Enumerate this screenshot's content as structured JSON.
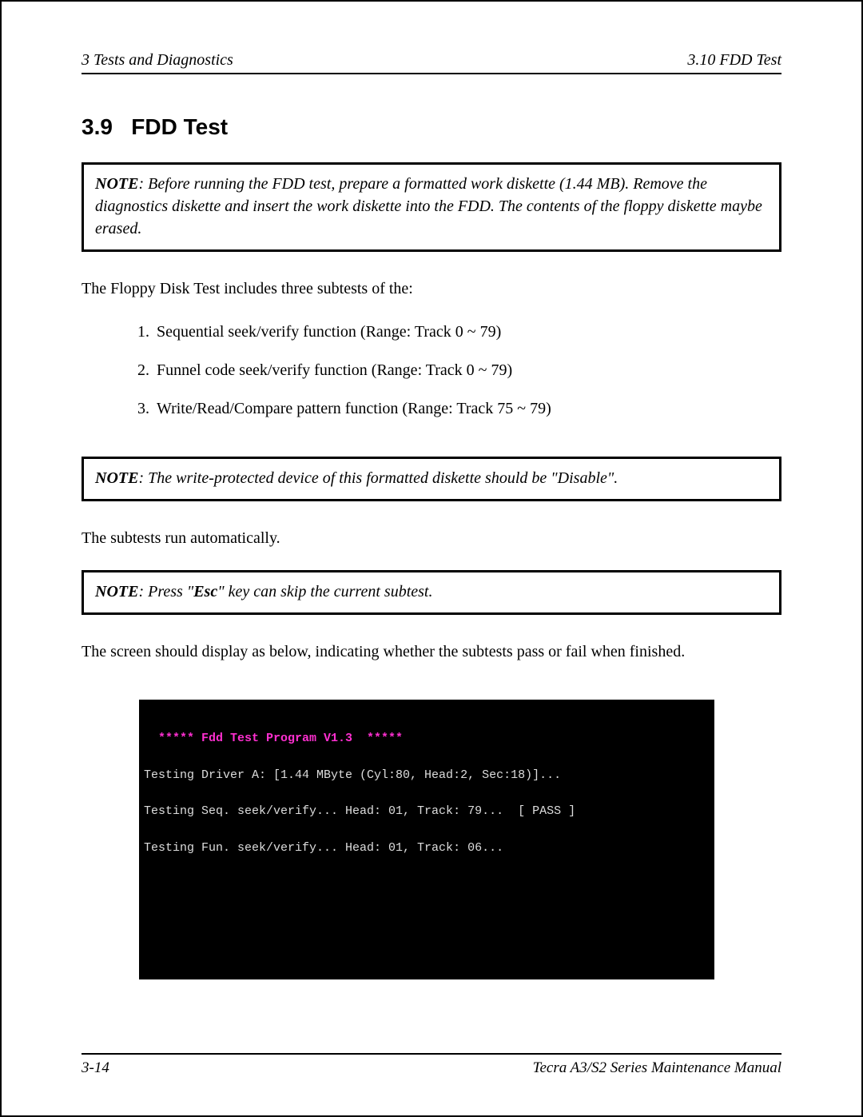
{
  "header": {
    "left": "3  Tests and Diagnostics",
    "right": "3.10  FDD Test"
  },
  "section": {
    "number": "3.9",
    "title": "FDD Test"
  },
  "note1": {
    "label": "NOTE",
    "text": ":  Before running the FDD test, prepare a formatted work diskette (1.44 MB). Remove the diagnostics diskette and insert the work diskette into the FDD.  The contents of the floppy diskette maybe erased."
  },
  "intro": "The Floppy Disk Test includes three subtests of the:",
  "subtests": [
    "Sequential seek/verify function (Range: Track 0 ~ 79)",
    "Funnel code seek/verify function (Range: Track 0 ~ 79)",
    "Write/Read/Compare pattern function (Range: Track 75 ~ 79)"
  ],
  "note2": {
    "label": "NOTE",
    "text": ":  The write-protected device of this formatted diskette should be \"Disable\"."
  },
  "auto_line": "The subtests run automatically.",
  "note3": {
    "label": "NOTE",
    "pre": ":  Press \"",
    "key": "Esc",
    "post": "\" key can skip the current subtest."
  },
  "result_line": "The screen should display as below, indicating whether the subtests pass or fail when finished.",
  "terminal": {
    "title": "  ***** Fdd Test Program V1.3  *****",
    "lines": [
      "Testing Driver A: [1.44 MByte (Cyl:80, Head:2, Sec:18)]...",
      "Testing Seq. seek/verify... Head: 01, Track: 79...  [ PASS ]",
      "Testing Fun. seek/verify... Head: 01, Track: 06..."
    ]
  },
  "footer": {
    "left": "3-14",
    "right": "Tecra A3/S2 Series Maintenance Manual"
  }
}
